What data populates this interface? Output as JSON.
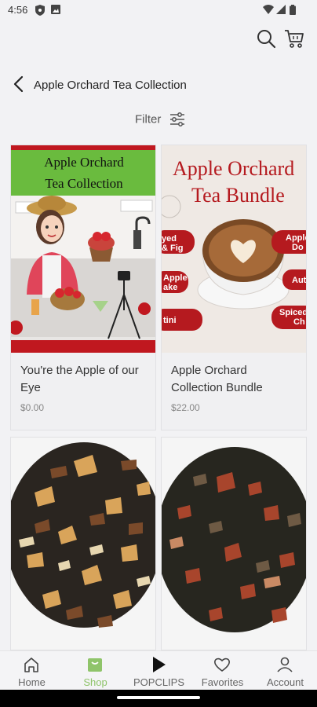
{
  "status_bar": {
    "time": "4:56"
  },
  "header": {
    "title": "Apple Orchard Tea Collection",
    "filter_label": "Filter"
  },
  "products": [
    {
      "name": "You're the Apple of our Eye",
      "price": "$0.00",
      "image_text": {
        "line1": "Apple Orchard",
        "line2": "Tea Collection"
      }
    },
    {
      "name": "Apple Orchard Collection Bundle",
      "price": "$22.00",
      "image_text": {
        "line1": "Apple Orchard",
        "line2": "Tea Bundle",
        "tags": [
          "yed",
          "& Fig",
          "Apple",
          "ake",
          "tini",
          "Apple",
          "Do",
          "Aut",
          "Spiced",
          "Ch"
        ]
      }
    },
    {
      "name": "",
      "price": ""
    },
    {
      "name": "",
      "price": ""
    }
  ],
  "bottom_nav": [
    {
      "label": "Home",
      "icon": "home-icon"
    },
    {
      "label": "Shop",
      "icon": "shop-icon",
      "active": true
    },
    {
      "label": "POPCLIPS",
      "icon": "play-icon"
    },
    {
      "label": "Favorites",
      "icon": "heart-icon"
    },
    {
      "label": "Account",
      "icon": "account-icon"
    }
  ],
  "colors": {
    "accent": "#8fc46a",
    "brand_red": "#c0181f",
    "green_banner": "#6abb3e"
  }
}
